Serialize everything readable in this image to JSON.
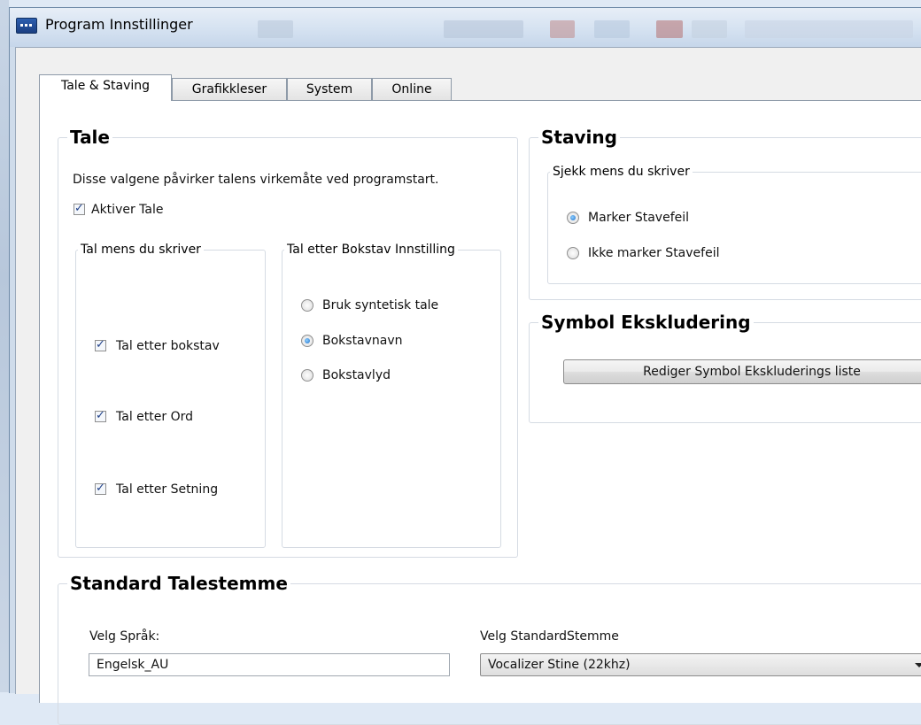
{
  "window": {
    "title": "Program Innstillinger"
  },
  "tabs": [
    {
      "label": "Tale & Staving",
      "active": true
    },
    {
      "label": "Grafikkleser",
      "active": false
    },
    {
      "label": "System",
      "active": false
    },
    {
      "label": "Online",
      "active": false
    }
  ],
  "tale": {
    "heading": "Tale",
    "description": "Disse valgene påvirker talens virkemåte ved programstart.",
    "aktiver_label": "Aktiver Tale",
    "aktiver_checked": true,
    "tal_mens": {
      "legend": "Tal mens du skriver",
      "items": [
        {
          "label": "Tal etter bokstav",
          "checked": true
        },
        {
          "label": "Tal etter Ord",
          "checked": true
        },
        {
          "label": "Tal etter Setning",
          "checked": true
        }
      ]
    },
    "bokstav": {
      "legend": "Tal etter Bokstav Innstilling",
      "options": [
        {
          "label": "Bruk syntetisk tale",
          "selected": false
        },
        {
          "label": "Bokstavnavn",
          "selected": true
        },
        {
          "label": "Bokstavlyd",
          "selected": false
        }
      ]
    }
  },
  "staving": {
    "heading": "Staving",
    "legend": "Sjekk mens du skriver",
    "options": [
      {
        "label": "Marker Stavefeil",
        "selected": true
      },
      {
        "label": "Ikke marker Stavefeil",
        "selected": false
      }
    ]
  },
  "symbol": {
    "heading": "Symbol Ekskludering",
    "button_label": "Rediger Symbol Ekskluderings liste"
  },
  "standard": {
    "heading": "Standard Talestemme",
    "language_label": "Velg Språk:",
    "language_value": "Engelsk_AU",
    "voice_label": "Velg StandardStemme",
    "voice_value": "Vocalizer Stine (22khz)"
  },
  "colors": {
    "selected_radio": "#1d6ec9",
    "check_mark": "#21428a",
    "groupbox_border": "#d5dbe3"
  }
}
